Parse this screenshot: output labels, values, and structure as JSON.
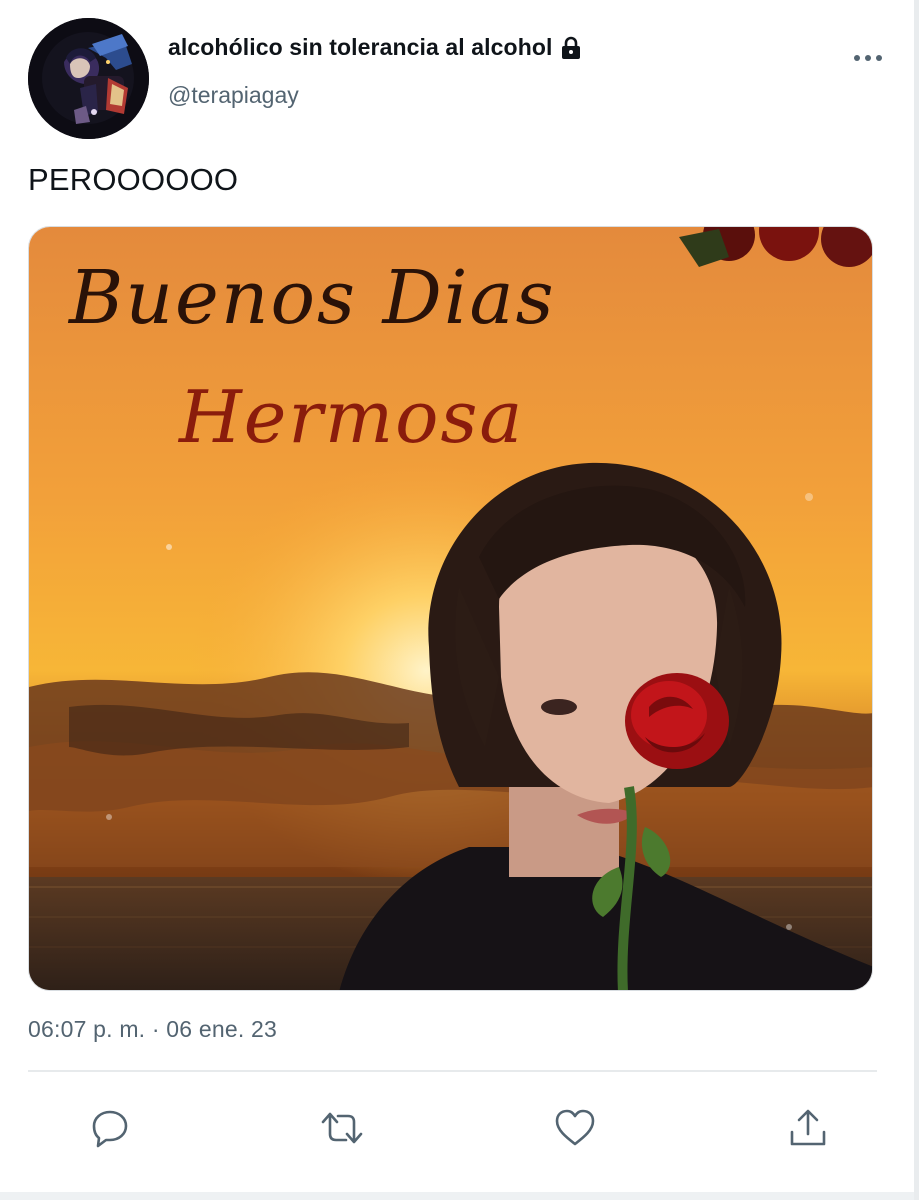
{
  "author": {
    "display_name": "alcohólico sin tolerancia al alcohol",
    "handle": "@terapiagay",
    "protected_icon": "lock-icon",
    "avatar_icon": "anime-character-avatar"
  },
  "tweet": {
    "text": "PEROOOOOO",
    "timestamp": "06:07 p. m. · 06 ene. 23"
  },
  "media": {
    "line_1": "Buenos Dias",
    "line_2": "Hermosa"
  },
  "actions": [
    {
      "name": "reply",
      "icon": "speech-bubble-icon"
    },
    {
      "name": "retweet",
      "icon": "retweet-icon"
    },
    {
      "name": "like",
      "icon": "heart-icon"
    },
    {
      "name": "share",
      "icon": "share-upload-icon"
    }
  ],
  "colors": {
    "text_primary": "#0f1419",
    "text_secondary": "#536471",
    "divider": "#e7eaec"
  }
}
